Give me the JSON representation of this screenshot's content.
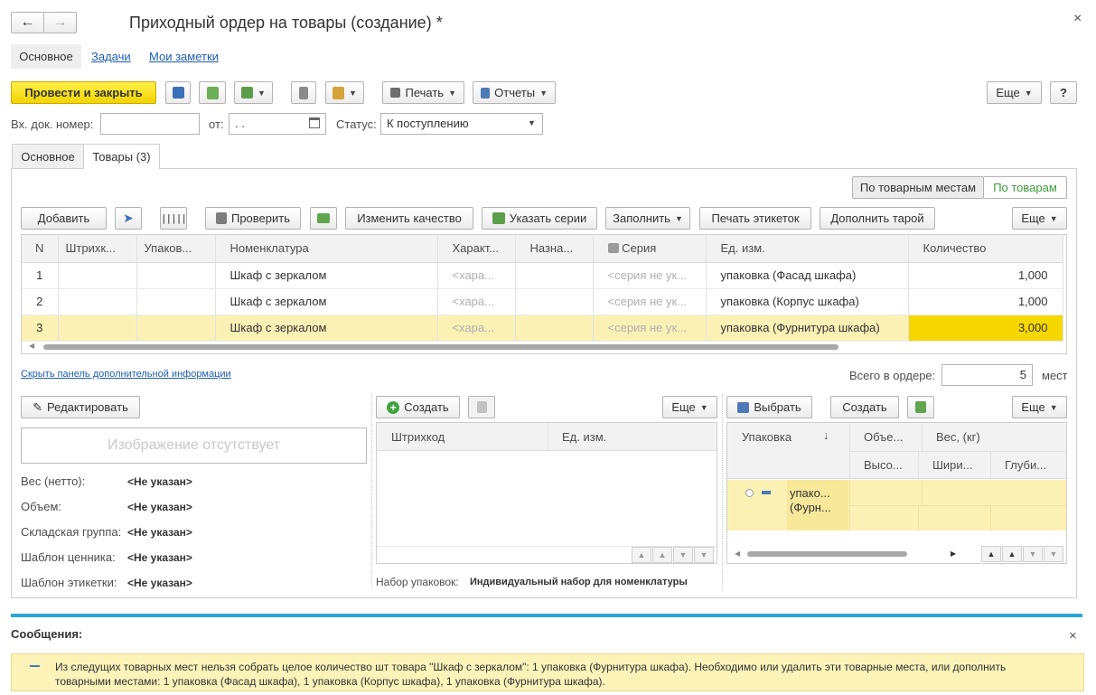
{
  "window": {
    "title": "Приходный ордер на товары (создание) *",
    "close_glyph": "×"
  },
  "top_tabs": [
    {
      "label": "Основное",
      "active": true
    },
    {
      "label": "Задачи",
      "active": false
    },
    {
      "label": "Мои заметки",
      "active": false
    }
  ],
  "toolbar": {
    "post_close": "Провести и закрыть",
    "print": "Печать",
    "reports": "Отчеты",
    "more": "Еще",
    "help": "?"
  },
  "header_fields": {
    "doc_number_label": "Вх. док. номер:",
    "doc_number_value": "",
    "date_label": "от:",
    "date_value": " .  .",
    "status_label": "Статус:",
    "status_value": "К поступлению"
  },
  "inner_tabs": [
    {
      "label": "Основное",
      "active": false
    },
    {
      "label": "Товары (3)",
      "active": true
    }
  ],
  "view_toggle": {
    "by_places": "По товарным местам",
    "by_goods": "По товарам"
  },
  "goods_toolbar": {
    "add": "Добавить",
    "check": "Проверить",
    "change_quality": "Изменить качество",
    "specify_series": "Указать серии",
    "fill": "Заполнить",
    "print_labels": "Печать этикеток",
    "add_tare": "Дополнить тарой",
    "more": "Еще"
  },
  "goods_table": {
    "columns": [
      "N",
      "Штрихк...",
      "Упаков...",
      "Номенклатура",
      "Характ...",
      "Назна...",
      "Серия",
      "Ед. изм.",
      "Количество"
    ],
    "rows": [
      {
        "n": "1",
        "barcode": "",
        "pack": "",
        "item": "Шкаф с зеркалом",
        "char": "<хара...",
        "purpose": "",
        "series": "<серия не ук...",
        "unit": "упаковка (Фасад шкафа)",
        "qty": "1,000"
      },
      {
        "n": "2",
        "barcode": "",
        "pack": "",
        "item": "Шкаф с зеркалом",
        "char": "<хара...",
        "purpose": "",
        "series": "<серия не ук...",
        "unit": "упаковка (Корпус шкафа)",
        "qty": "1,000"
      },
      {
        "n": "3",
        "barcode": "",
        "pack": "",
        "item": "Шкаф с зеркалом",
        "char": "<хара...",
        "purpose": "",
        "series": "<серия не ук...",
        "unit": "упаковка (Фурнитура шкафа)",
        "qty": "3,000"
      }
    ]
  },
  "info_panel": {
    "hide_link": "Скрыть панель дополнительной информации",
    "total_label": "Всего в ордере:",
    "total_value": "5",
    "total_unit": "мест"
  },
  "left_panel": {
    "edit_button": "Редактировать",
    "no_image": "Изображение отсутствует",
    "props": [
      {
        "label": "Вес (нетто):",
        "value": "<Не указан>"
      },
      {
        "label": "Объем:",
        "value": "<Не указан>"
      },
      {
        "label": "Складская группа:",
        "value": "<Не указан>"
      },
      {
        "label": "Шаблон ценника:",
        "value": "<Не указан>"
      },
      {
        "label": "Шаблон этикетки:",
        "value": "<Не указан>"
      }
    ]
  },
  "barcode_panel": {
    "create": "Создать",
    "more": "Еще",
    "columns": [
      "Штрихкод",
      "Ед. изм."
    ],
    "pack_set_label": "Набор упаковок:",
    "pack_set_value": "Индивидуальный набор для номенклатуры"
  },
  "pack_panel": {
    "select": "Выбрать",
    "create": "Создать",
    "more": "Еще",
    "col_pack": "Упаковка",
    "col_volume": "Объе...",
    "col_weight": "Вес, (кг)",
    "col_height": "Высо...",
    "col_width": "Шири...",
    "col_depth": "Глуби...",
    "row_line1": "упако...",
    "row_line2": "(Фурн..."
  },
  "messages": {
    "title": "Сообщения:",
    "text": "Из следущих товарных мест нельзя собрать целое количество шт товара \"Шкаф с зеркалом\": 1 упаковка (Фурнитура шкафа). Необходимо или удалить эти товарные места, или дополнить товарными местами: 1 упаковка (Фасад шкафа), 1 упаковка (Корпус шкафа), 1 упаковка (Фурнитура шкафа)."
  },
  "colors": {
    "accent_yellow": "#f2d400",
    "selected_row": "#fbf1b5",
    "message_bar": "#2ca6d9",
    "link": "#1e5eaf"
  }
}
